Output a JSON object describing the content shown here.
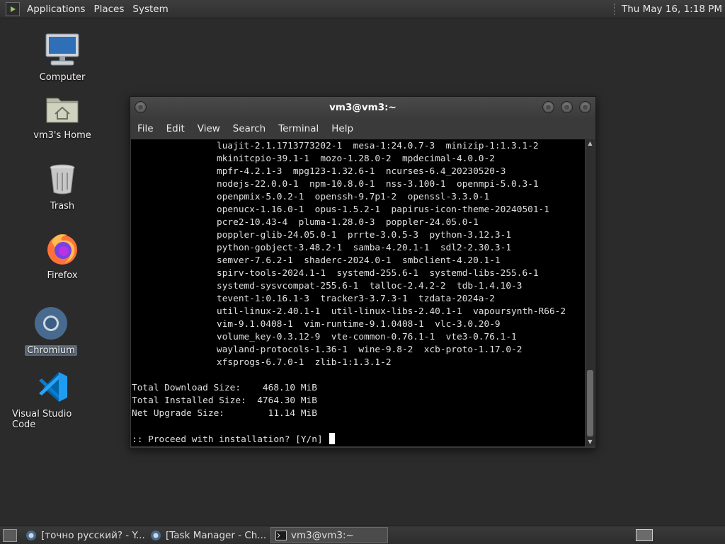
{
  "top_panel": {
    "menus": [
      "Applications",
      "Places",
      "System"
    ],
    "clock": "Thu May 16,  1:18 PM"
  },
  "desktop_icons": [
    {
      "label": "Computer",
      "icon": "computer-icon"
    },
    {
      "label": "vm3's Home",
      "icon": "home-folder-icon"
    },
    {
      "label": "Trash",
      "icon": "trash-icon"
    },
    {
      "label": "Firefox",
      "icon": "firefox-icon"
    },
    {
      "label": "Chromium",
      "icon": "chromium-icon",
      "selected": true
    },
    {
      "label": "Visual Studio Code",
      "icon": "vscode-icon"
    }
  ],
  "window": {
    "title": "vm3@vm3:~",
    "menu": [
      "File",
      "Edit",
      "View",
      "Search",
      "Terminal",
      "Help"
    ]
  },
  "terminal": {
    "package_lines": [
      "luajit-2.1.1713773202-1  mesa-1:24.0.7-3  minizip-1:1.3.1-2",
      "mkinitcpio-39.1-1  mozo-1.28.0-2  mpdecimal-4.0.0-2",
      "mpfr-4.2.1-3  mpg123-1.32.6-1  ncurses-6.4_20230520-3",
      "nodejs-22.0.0-1  npm-10.8.0-1  nss-3.100-1  openmpi-5.0.3-1",
      "openpmix-5.0.2-1  openssh-9.7p1-2  openssl-3.3.0-1",
      "openucx-1.16.0-1  opus-1.5.2-1  papirus-icon-theme-20240501-1",
      "pcre2-10.43-4  pluma-1.28.0-3  poppler-24.05.0-1",
      "poppler-glib-24.05.0-1  prrte-3.0.5-3  python-3.12.3-1",
      "python-gobject-3.48.2-1  samba-4.20.1-1  sdl2-2.30.3-1",
      "semver-7.6.2-1  shaderc-2024.0-1  smbclient-4.20.1-1",
      "spirv-tools-2024.1-1  systemd-255.6-1  systemd-libs-255.6-1",
      "systemd-sysvcompat-255.6-1  talloc-2.4.2-2  tdb-1.4.10-3",
      "tevent-1:0.16.1-3  tracker3-3.7.3-1  tzdata-2024a-2",
      "util-linux-2.40.1-1  util-linux-libs-2.40.1-1  vapoursynth-R66-2",
      "vim-9.1.0408-1  vim-runtime-9.1.0408-1  vlc-3.0.20-9",
      "volume_key-0.3.12-9  vte-common-0.76.1-1  vte3-0.76.1-1",
      "wayland-protocols-1.36-1  wine-9.8-2  xcb-proto-1.17.0-2",
      "xfsprogs-6.7.0-1  zlib-1:1.3.1-2"
    ],
    "summary": [
      "Total Download Size:    468.10 MiB",
      "Total Installed Size:  4764.30 MiB",
      "Net Upgrade Size:        11.14 MiB"
    ],
    "prompt": ":: Proceed with installation? [Y/n] "
  },
  "taskbar": {
    "tasks": [
      {
        "label": "[точно русский? - Y...",
        "icon": "chromium-icon",
        "active": false
      },
      {
        "label": "[Task Manager - Ch...",
        "icon": "chromium-icon",
        "active": false
      },
      {
        "label": "vm3@vm3:~",
        "icon": "terminal-icon",
        "active": true
      }
    ]
  }
}
